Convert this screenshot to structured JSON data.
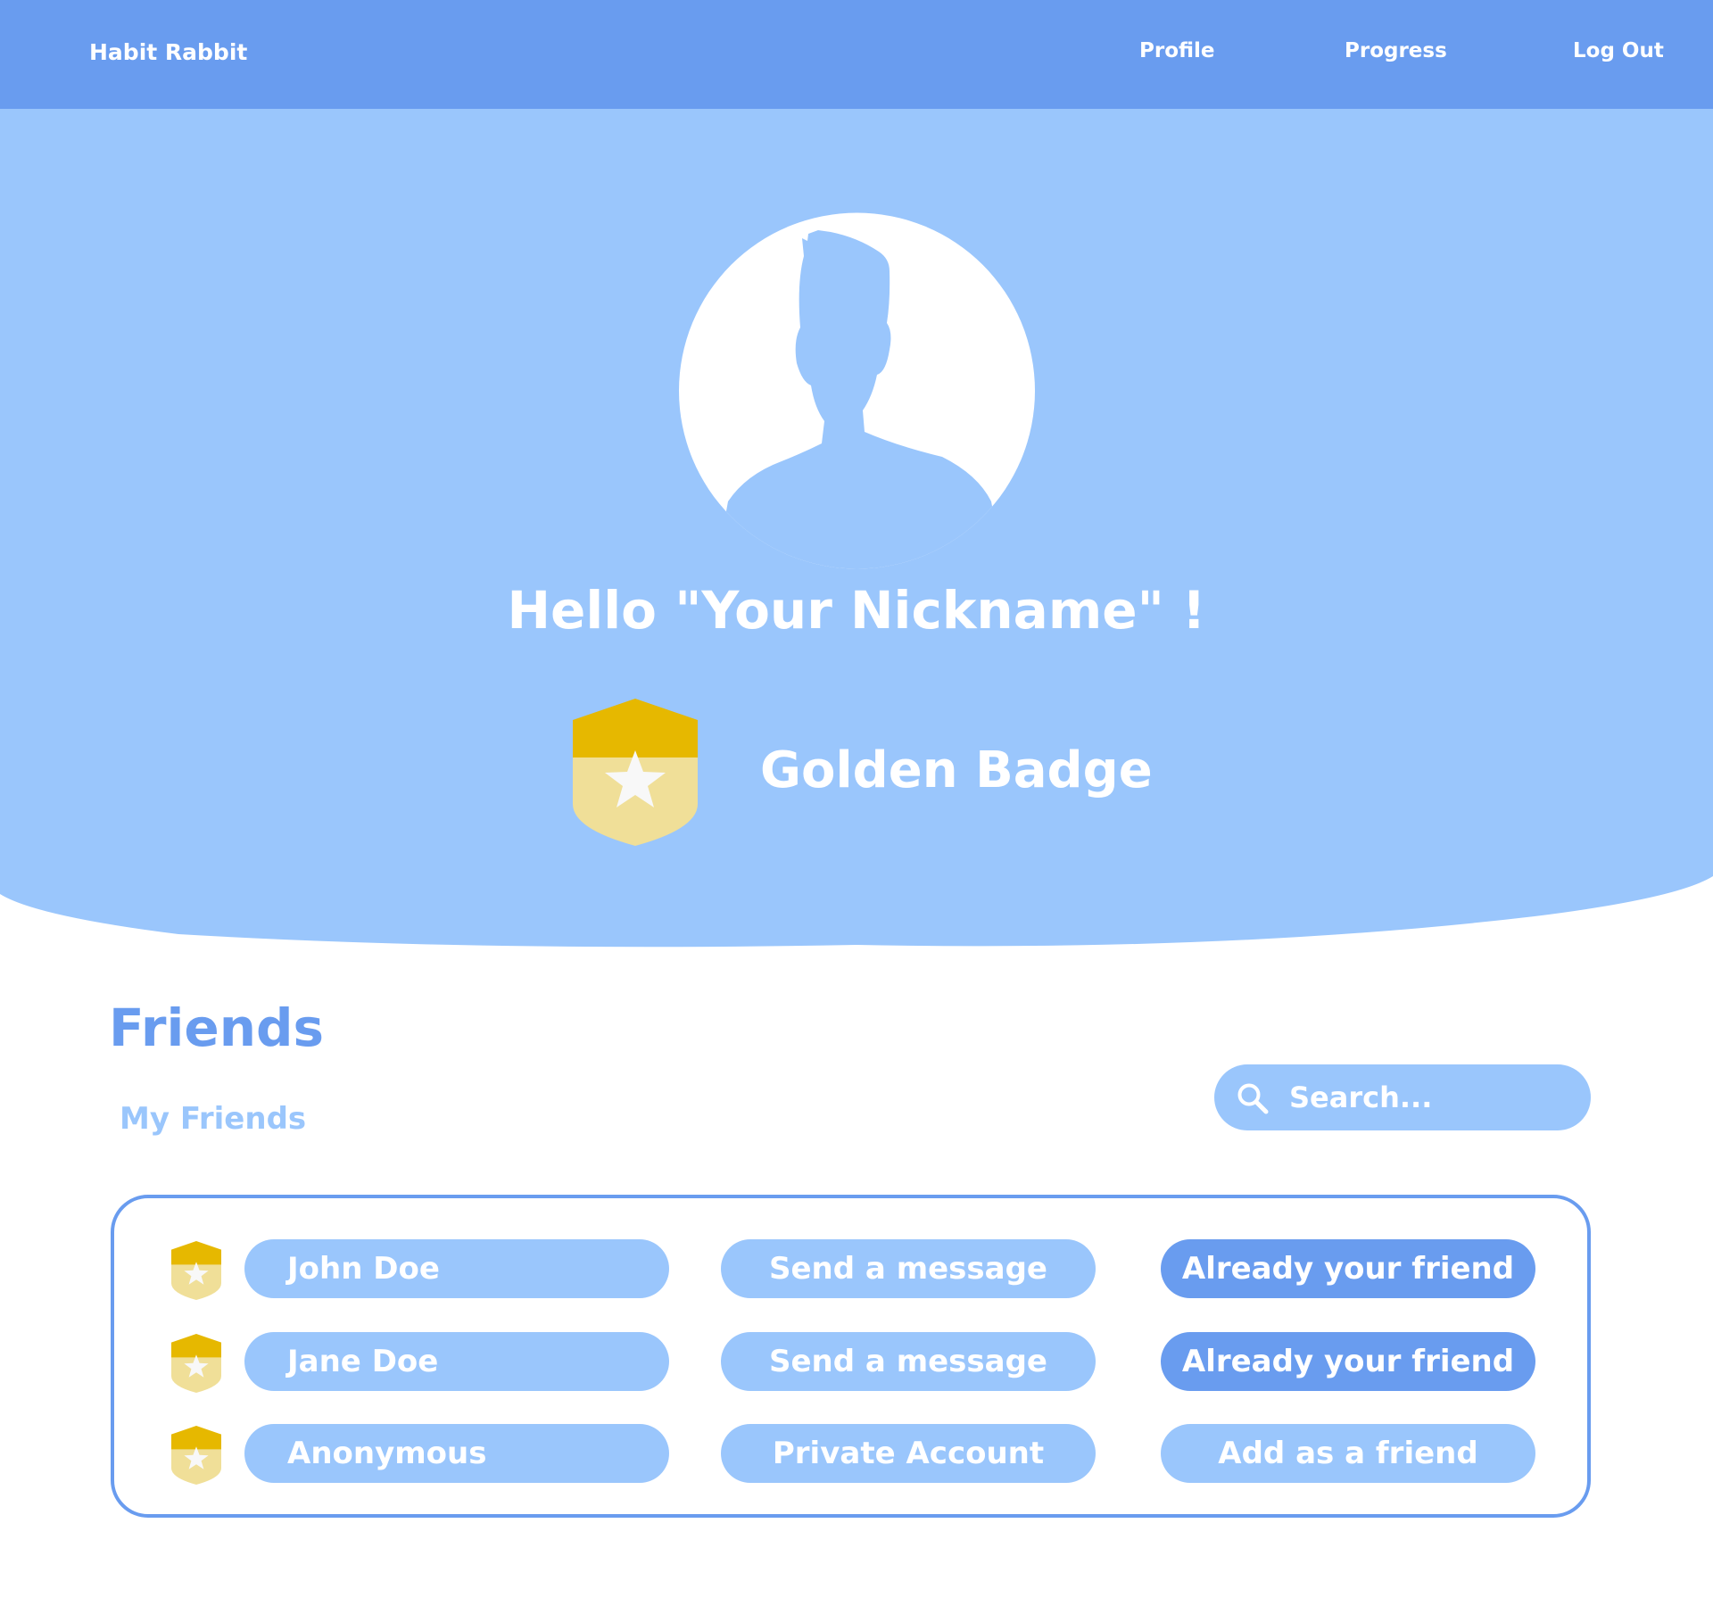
{
  "app": {
    "name": "Habit Rabbit"
  },
  "nav": {
    "items": [
      {
        "label": "Profile"
      },
      {
        "label": "Progress"
      },
      {
        "label": "Log Out"
      }
    ]
  },
  "colors": {
    "nav": "#699cef",
    "hero": "#9ac6fc",
    "badge_dark": "#e6b800",
    "badge_light": "#f0df98",
    "star": "#f8f8f8"
  },
  "profile": {
    "greeting": "Hello \"Your Nickname\" !",
    "badge": {
      "label": "Golden Badge",
      "icon": "gold-shield-star-icon"
    },
    "avatar_icon": "user-silhouette-icon"
  },
  "friends": {
    "title": "Friends",
    "subtitle": "My Friends",
    "search": {
      "placeholder": "Search...",
      "icon": "search-icon"
    },
    "rows": [
      {
        "name": "John Doe",
        "action": "Send a message",
        "status": "Already your friend"
      },
      {
        "name": "Jane Doe",
        "action": "Send a message",
        "status": "Already your friend"
      },
      {
        "name": "Anonymous",
        "action": "Private Account",
        "status": "Add as a friend"
      }
    ]
  }
}
